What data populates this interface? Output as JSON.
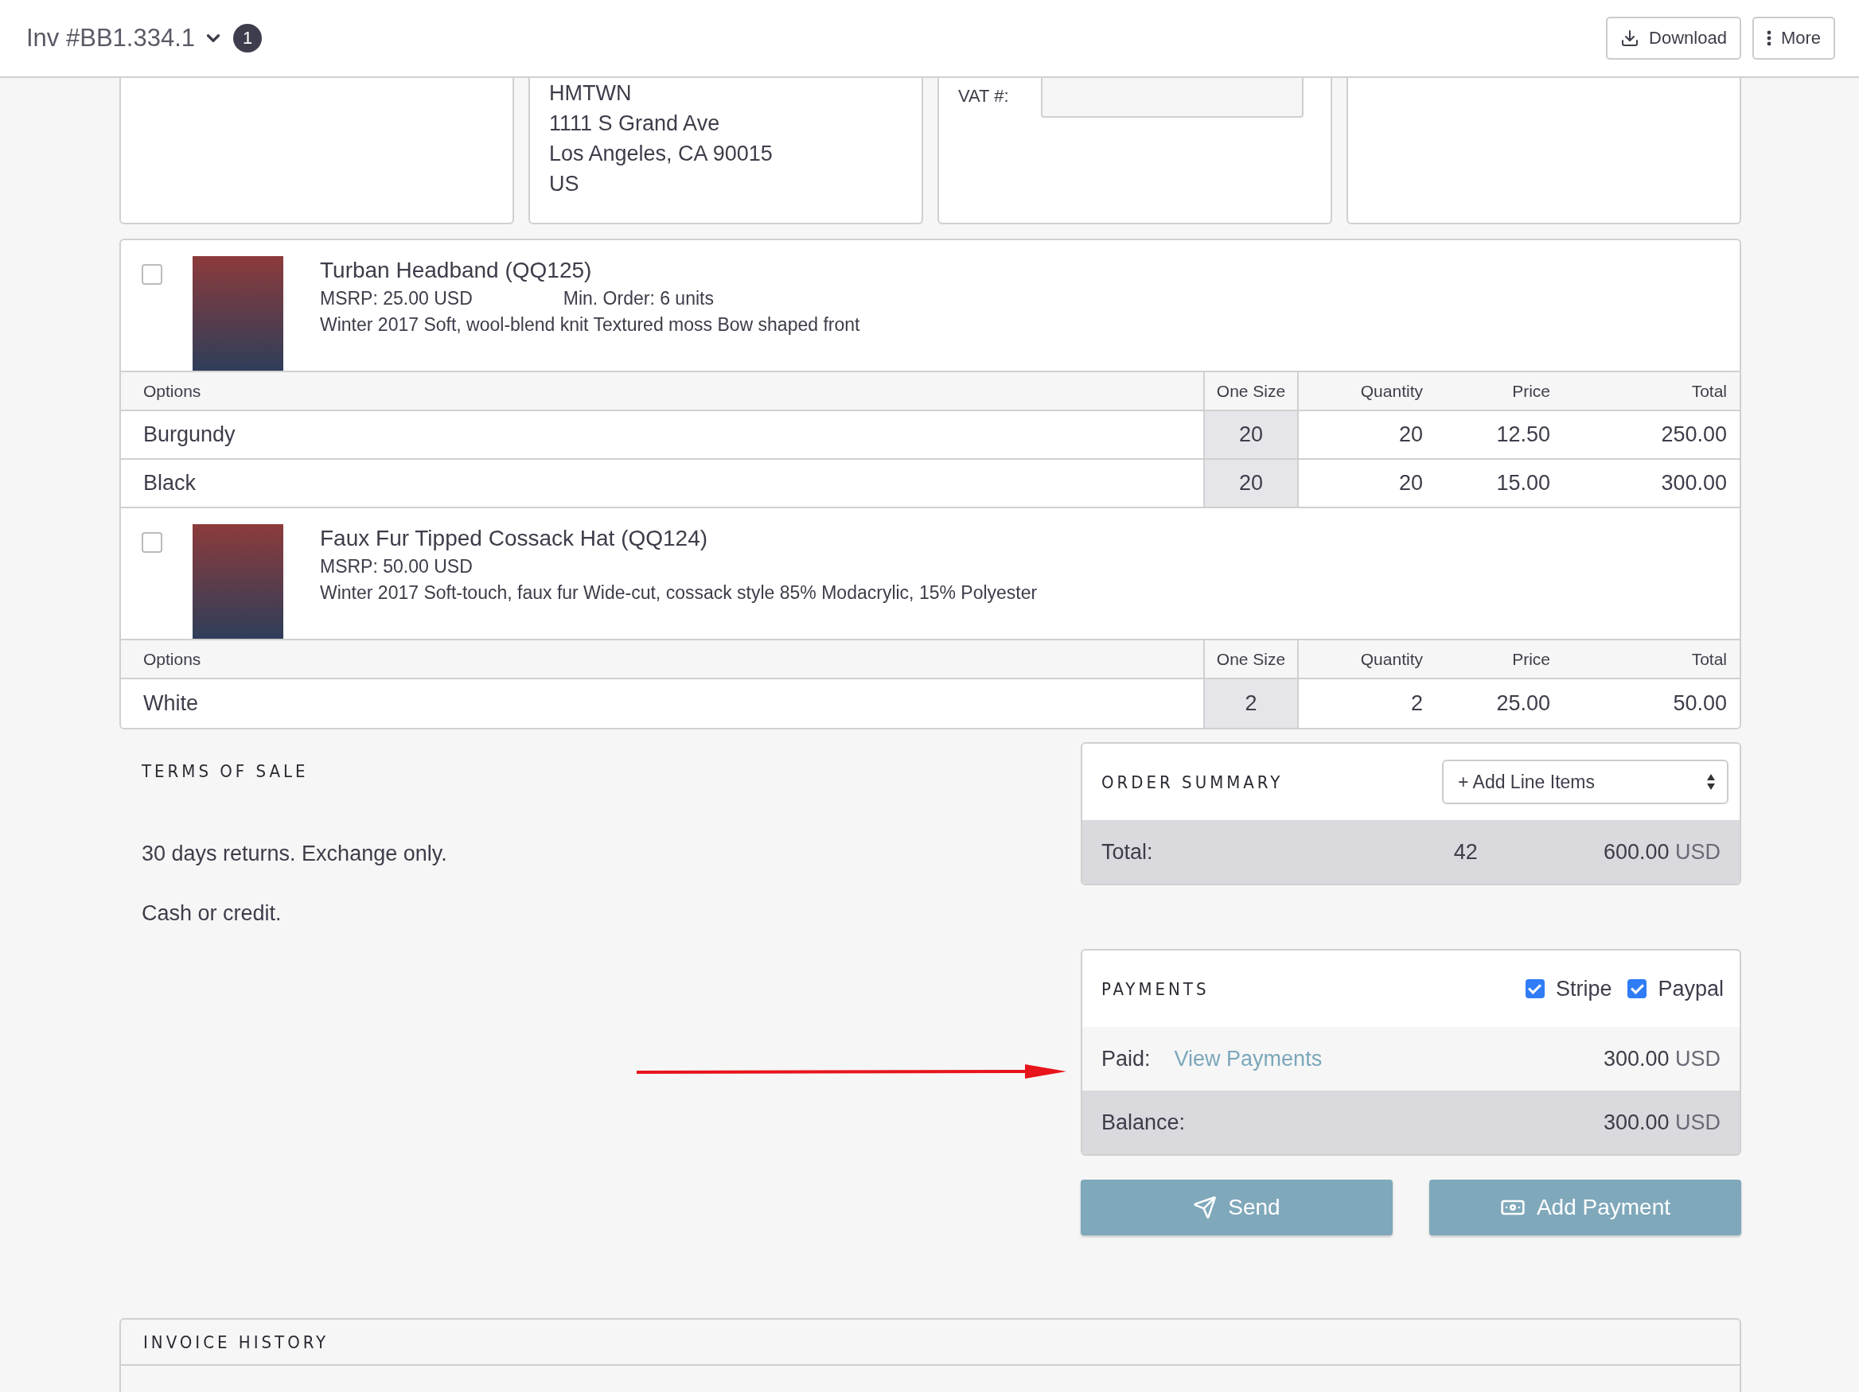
{
  "header": {
    "title": "Inv #BB1.334.1",
    "badge": "1",
    "buttons": [
      {
        "label": "Download",
        "kind": "download"
      },
      {
        "label": "More",
        "kind": "more"
      }
    ]
  },
  "top_cards": [
    {
      "kind": "blank"
    },
    {
      "kind": "address",
      "lines": [
        "HMTWN",
        "1111 S Grand Ave",
        "Los Angeles, CA 90015",
        "US"
      ]
    },
    {
      "kind": "vat",
      "label": "VAT #:"
    },
    {
      "kind": "blank"
    }
  ],
  "products": [
    {
      "name": "Turban Headband (QQ125)",
      "checked": false,
      "msrp": "MSRP: 25.00 USD",
      "min_order": "Min. Order: 6 units",
      "description": "Winter 2017 Soft, wool-blend knit Textured moss Bow shaped front",
      "columns": [
        "Options",
        "One Size",
        "Quantity",
        "Price",
        "Total"
      ],
      "rows": [
        {
          "option": "Burgundy",
          "one_size": "20",
          "quantity": "20",
          "price": "12.50",
          "total": "250.00"
        },
        {
          "option": "Black",
          "one_size": "20",
          "quantity": "20",
          "price": "15.00",
          "total": "300.00"
        }
      ]
    },
    {
      "name": "Faux Fur Tipped Cossack Hat (QQ124)",
      "checked": false,
      "msrp": "MSRP: 50.00 USD",
      "description": "Winter 2017 Soft-touch, faux fur Wide-cut, cossack style 85% Modacrylic, 15% Polyester",
      "columns": [
        "Options",
        "One Size",
        "Quantity",
        "Price",
        "Total"
      ],
      "rows": [
        {
          "option": "White",
          "one_size": "2",
          "quantity": "2",
          "price": "25.00",
          "total": "50.00"
        }
      ]
    }
  ],
  "terms": {
    "title": "TERMS OF SALE",
    "paragraphs": [
      "30 days returns. Exchange only.",
      "Cash or credit."
    ]
  },
  "order_summary": {
    "title": "ORDER SUMMARY",
    "add_select": "+ Add Line Items",
    "total_label": "Total:",
    "total_quantity": "42",
    "total_amount": "600.00",
    "total_currency": "USD"
  },
  "payments": {
    "title": "PAYMENTS",
    "methods": [
      {
        "label": "Stripe",
        "checked": true
      },
      {
        "label": "Paypal",
        "checked": true
      }
    ],
    "paid_label": "Paid:",
    "link": "View Payments",
    "paid_amount": "300.00",
    "paid_currency": "USD",
    "balance_label": "Balance:",
    "balance_amount": "300.00",
    "balance_currency": "USD"
  },
  "actions": [
    {
      "label": "Send",
      "kind": "send"
    },
    {
      "label": "Add Payment",
      "kind": "payment"
    }
  ],
  "invoice_history": {
    "title": "INVOICE HISTORY"
  }
}
